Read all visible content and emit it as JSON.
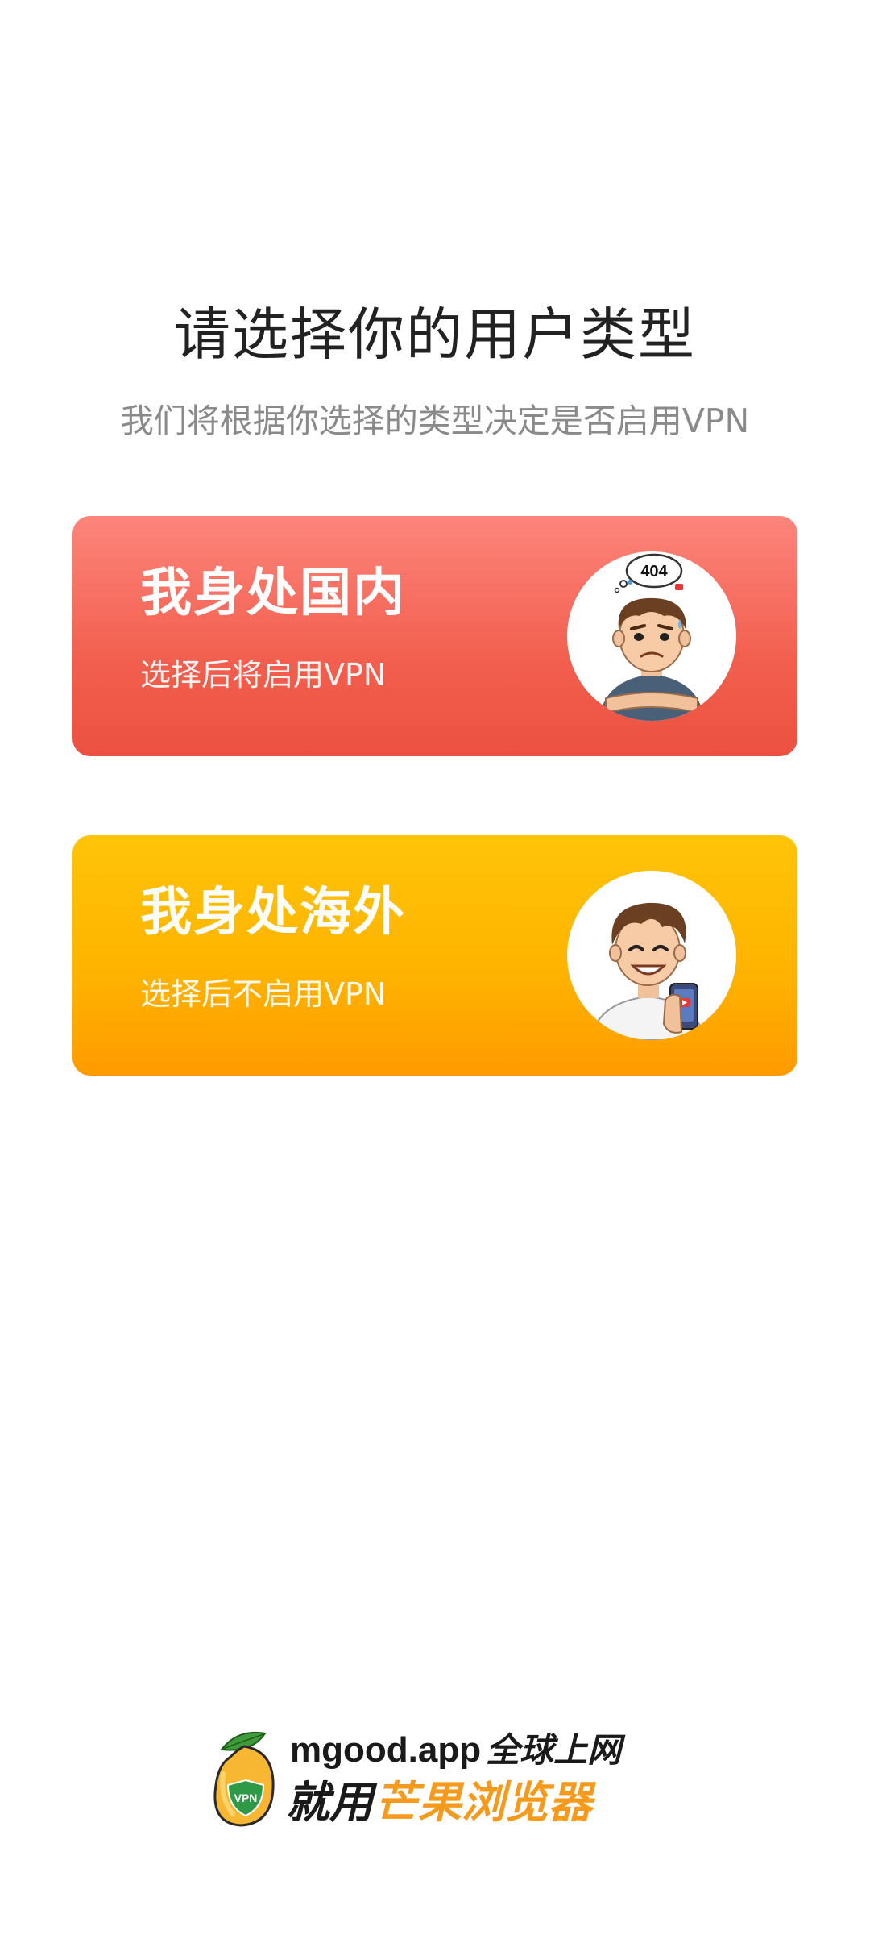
{
  "header": {
    "title": "请选择你的用户类型",
    "subtitle": "我们将根据你选择的类型决定是否启用VPN"
  },
  "options": [
    {
      "title": "我身处国内",
      "desc": "选择后将启用VPN",
      "illustration_badge": "404",
      "illustration": "worried-boy-icon",
      "accent": "#f25f4e"
    },
    {
      "title": "我身处海外",
      "desc": "选择后不启用VPN",
      "illustration": "happy-boy-phone-icon",
      "accent": "#ffb400"
    }
  ],
  "footer": {
    "domain": "mgood.app",
    "slogan": "全球上网",
    "line2_prefix": "就用",
    "brand": "芒果浏览器",
    "logo_badge": "VPN",
    "brand_color": "#f59a1c"
  }
}
